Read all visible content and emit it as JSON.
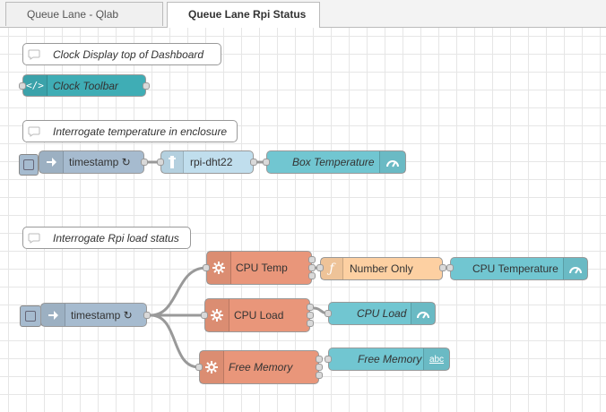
{
  "tabs": [
    {
      "label": "Queue Lane - Qlab",
      "active": false
    },
    {
      "label": "Queue Lane Rpi Status",
      "active": true
    }
  ],
  "flow": {
    "clock_comment": "Clock Display top of Dashboard",
    "clock_toolbar": "Clock Toolbar",
    "temp_comment": "Interrogate temperature in enclosure",
    "timestamp_1": "timestamp ↻",
    "rpi_dht22": "rpi-dht22",
    "box_temperature": "Box Temperature",
    "load_comment": "Interrogate Rpi load status",
    "timestamp_2": "timestamp ↻",
    "cpu_temp": "CPU Temp",
    "number_only": "Number Only",
    "cpu_temperature": "CPU Temperature",
    "cpu_load_exec": "CPU Load",
    "cpu_load_gauge": "CPU Load",
    "free_memory_exec": "Free Memory",
    "free_memory_text": "Free Memory",
    "text_badge": "abc"
  },
  "colors": {
    "inject": "#a6bbcf",
    "template": "#3fadb5",
    "rpi": "#c0deed",
    "ui": "#71c6d1",
    "exec": "#e9967a",
    "function": "#fdd0a2",
    "wire": "#999999"
  }
}
